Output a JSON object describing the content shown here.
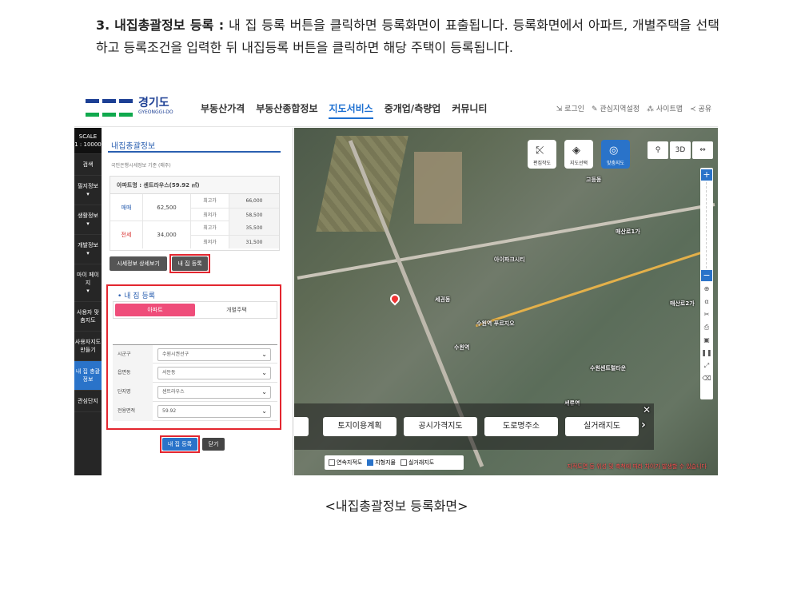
{
  "doc": {
    "step_num": "3.",
    "step_title": "내집총괄정보 등록 :",
    "body_text": "내 집 등록 버튼을 클릭하면 등록화면이 표출됩니다. 등록화면에서 아파트, 개별주택을 선택하고 등록조건을 입력한 뒤 내집등록 버튼을 클릭하면 해당 주택이 등록됩니다.",
    "caption": "<내집총괄정보 등록화면>"
  },
  "header": {
    "logo_text": "경기도",
    "logo_sub": "GYEONGGI-DO",
    "nav": [
      "부동산가격",
      "부동산종합정보",
      "지도서비스",
      "중개업/측량업",
      "커뮤니티"
    ],
    "util": [
      "로그인",
      "관심지역설정",
      "사이트맵",
      "공유"
    ]
  },
  "rail": {
    "scale_label": "SCALE",
    "scale_value": "1 : 10000",
    "items": [
      "검색",
      "필지정보",
      "생활정보",
      "개발정보",
      "마이 페이지",
      "사용자 맞춤지도",
      "사용자지도 만들기",
      "내 집 총괄정보",
      "관심단지"
    ]
  },
  "panel": {
    "title": "내집총괄정보",
    "basis": "국민은행시세정보 기준 (매주)",
    "apt_name": "아파트명 : 센트라우스(59.92 ㎡)",
    "prices": [
      {
        "type": "매매",
        "value": "62,500",
        "high_label": "최고가",
        "high": "66,000",
        "low_label": "최저가",
        "low": "58,500"
      },
      {
        "type": "전세",
        "value": "34,000",
        "high_label": "최고가",
        "high": "35,500",
        "low_label": "최저가",
        "low": "31,500"
      }
    ],
    "detail_button": "시세정보 상세보기",
    "register_button": "내 집 등록"
  },
  "register": {
    "title": "• 내 집 등록",
    "tabs": [
      "아파트",
      "개별주택"
    ],
    "fields": [
      {
        "label": "시군구",
        "value": "수원시권선구"
      },
      {
        "label": "읍면동",
        "value": "서둔동"
      },
      {
        "label": "단지명",
        "value": "센트라우스"
      },
      {
        "label": "전용면적",
        "value": "59.92"
      }
    ],
    "submit_button": "내 집 등록",
    "close_button": "닫기"
  },
  "map": {
    "tools": [
      "편집작도",
      "지도선택",
      "맞춤지도"
    ],
    "top_right": [
      "⚲",
      "3D",
      "⇔"
    ],
    "bottom_buttons": [
      "토지이용계획",
      "공시가격지도",
      "도로명주소",
      "실거래지도"
    ],
    "layers": [
      {
        "label": "연속지적도",
        "checked": false
      },
      {
        "label": "지형지물",
        "checked": true
      },
      {
        "label": "실거래지도",
        "checked": false
      }
    ],
    "labels": [
      "수원역",
      "세권동",
      "고등동",
      "매산로1가",
      "매산로2가",
      "아이파크시티",
      "수원센트럴타운",
      "세류역",
      "수원역 푸르지오"
    ],
    "notice": "지적도면 등 위성 및 축척에 따라 차이가 발생할 수 있습니다"
  }
}
